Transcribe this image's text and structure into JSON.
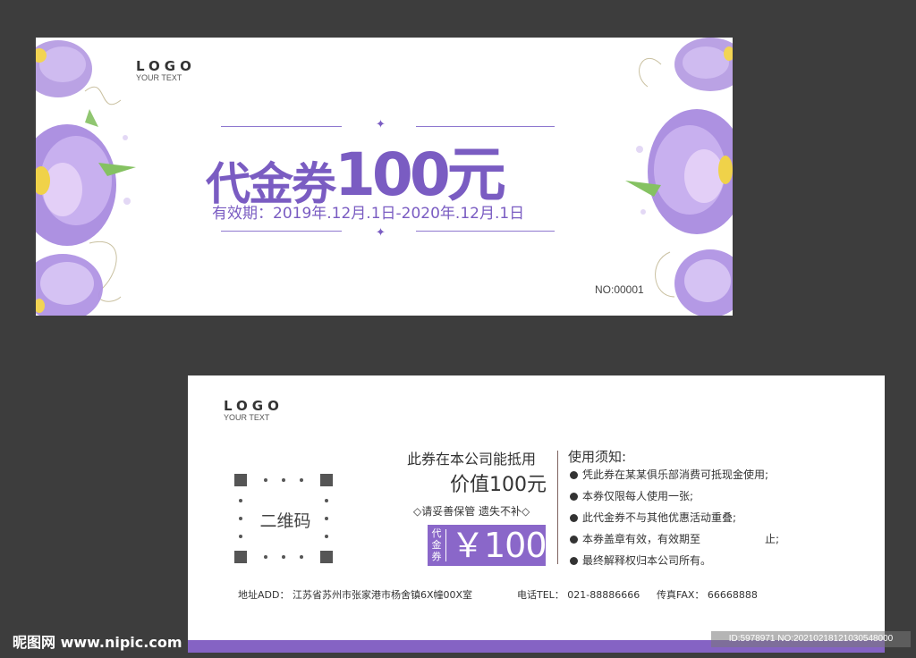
{
  "front": {
    "logo": {
      "main": "LOGO",
      "sub": "YOUR TEXT"
    },
    "title_text": "代金券",
    "title_amount": "100元",
    "validity": "有效期：2019年.12月.1日-2020年.12月.1日",
    "serial": "NO:00001",
    "star": "✦"
  },
  "back": {
    "logo": {
      "main": "LOGO",
      "sub": "YOUR TEXT"
    },
    "qr_label": "二维码",
    "offer_line1": "此券在本公司能抵用",
    "offer_line2": "价值100元",
    "keep_notice": "◇请妥善保管 遗失不补◇",
    "price_tag": "代金券",
    "price_amount": "￥100",
    "notes_title": "使用须知:",
    "notes": [
      "凭此券在某某俱乐部消费可抵现金使用;",
      "本券仅限每人使用一张;",
      "此代金券不与其他优惠活动重叠;",
      "本券盖章有效，有效期至",
      "最终解释权归本公司所有。"
    ],
    "notes_4_suffix": "止;",
    "address": "地址ADD：  江苏省苏州市张家港市杨舍镇6X幢00X室",
    "phone": "电话TEL：  021-88886666",
    "fax": "传真FAX：  66668888"
  },
  "watermark": {
    "site": "昵图网 www.nipic.com",
    "id": "ID:5978971 NO:20210218121030548000"
  },
  "colors": {
    "accent": "#7a5cc2",
    "background": "#3d3d3d",
    "bar": "#8563c4"
  }
}
